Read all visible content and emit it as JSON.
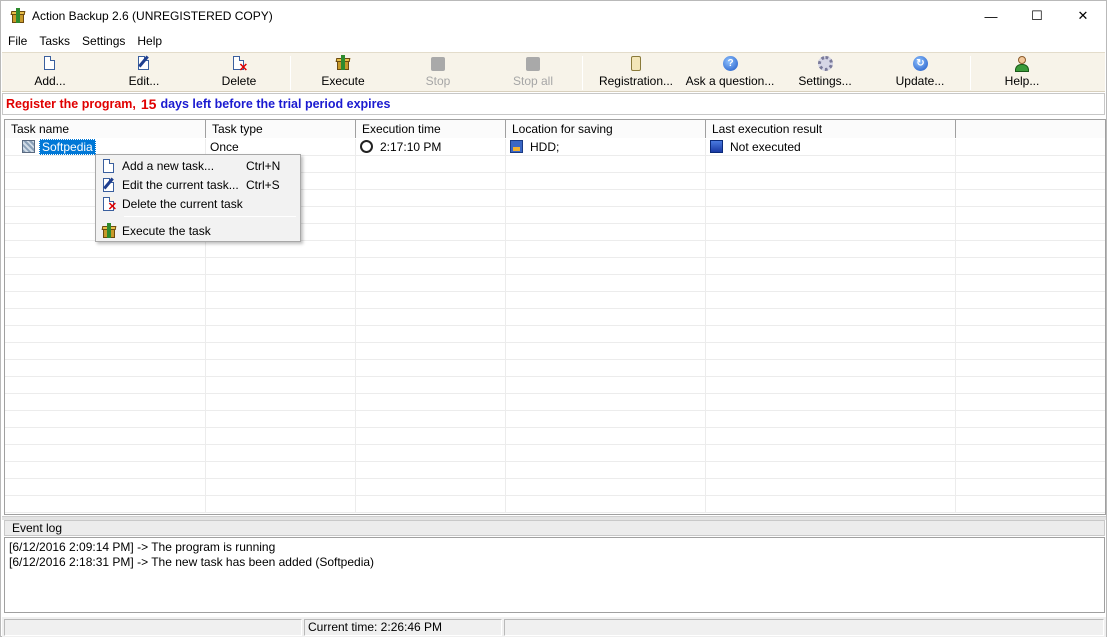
{
  "window": {
    "title": "Action Backup 2.6 (UNREGISTERED COPY)",
    "minimize": "—",
    "maximize": "☐",
    "close": "✕"
  },
  "menu": [
    "File",
    "Tasks",
    "Settings",
    "Help"
  ],
  "toolbar": {
    "add": "Add...",
    "edit": "Edit...",
    "delete": "Delete",
    "execute": "Execute",
    "stop": "Stop",
    "stop_all": "Stop all",
    "registration": "Registration...",
    "ask": "Ask a question...",
    "settings": "Settings...",
    "update": "Update...",
    "help": "Help..."
  },
  "trial": {
    "prefix": "Register the program,",
    "days": "15",
    "suffix": "days left before the trial period expires"
  },
  "table": {
    "columns": [
      "Task name",
      "Task type",
      "Execution time",
      "Location for saving",
      "Last execution result"
    ],
    "rows": [
      {
        "name": "Softpedia",
        "type": "Once",
        "time": "2:17:10 PM",
        "location": "HDD;",
        "result": "Not executed"
      }
    ]
  },
  "context_menu": {
    "items": [
      {
        "label": "Add a new task...",
        "shortcut": "Ctrl+N",
        "icon": "new-document-icon"
      },
      {
        "label": "Edit the current task...",
        "shortcut": "Ctrl+S",
        "icon": "edit-document-icon"
      },
      {
        "label": "Delete the current task",
        "shortcut": "",
        "icon": "delete-document-icon"
      },
      {
        "label": "Execute the task",
        "shortcut": "",
        "icon": "execute-box-icon"
      }
    ]
  },
  "event_log": {
    "title": "Event log",
    "lines": [
      "[6/12/2016 2:09:14 PM] -> The program is running",
      "[6/12/2016 2:18:31 PM] -> The new task has been added  (Softpedia)"
    ]
  },
  "status": {
    "current_time": "Current time: 2:26:46 PM"
  },
  "colors": {
    "trial_red": "#e00000",
    "trial_blue": "#1a1ad0",
    "selection": "#0078d7",
    "toolbar_bg": "#f7f3e9"
  }
}
